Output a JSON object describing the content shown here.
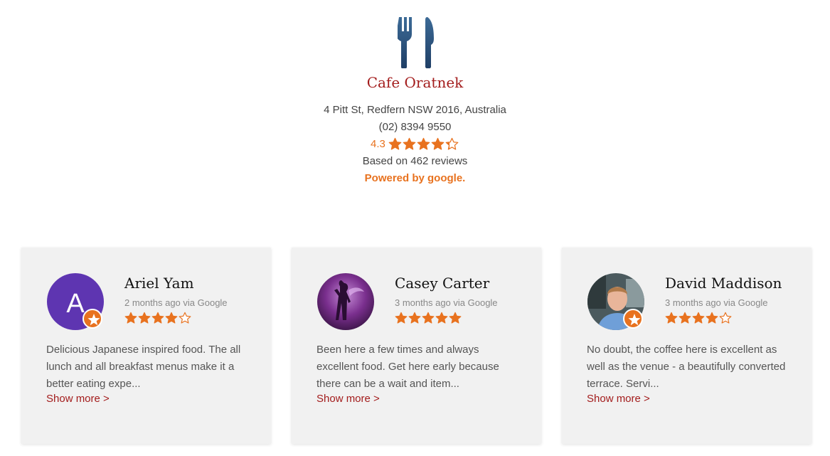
{
  "business": {
    "name": "Cafe Oratnek",
    "address": "4 Pitt St, Redfern NSW 2016, Australia",
    "phone": "(02) 8394 9550",
    "rating": "4.3",
    "rating_value": 4.3,
    "reviews_text": "Based on 462 reviews",
    "powered": "Powered by google.",
    "logo_icon": "fork-knife-icon"
  },
  "colors": {
    "accent": "#e8721f",
    "brand_red": "#a31c1c",
    "card_bg": "#f1f1f1"
  },
  "reviews": [
    {
      "name": "Ariel Yam",
      "meta": "2 months ago via Google",
      "stars": 4,
      "avatar_letter": "A",
      "text": "Delicious Japanese inspired food. The all lunch and all breakfast menus make it a better eating expe...",
      "more": "Show more >"
    },
    {
      "name": "Casey Carter",
      "meta": "3 months ago via Google",
      "stars": 5,
      "avatar_letter": "",
      "text": "Been here a few times and always excellent food. Get here early because there can be a wait and item...",
      "more": "Show more >"
    },
    {
      "name": "David Maddison",
      "meta": "3 months ago via Google",
      "stars": 4,
      "avatar_letter": "",
      "text": "No doubt, the coffee here is excellent as well as the venue - a beautifully converted terrace. Servi...",
      "more": "Show more >"
    }
  ]
}
